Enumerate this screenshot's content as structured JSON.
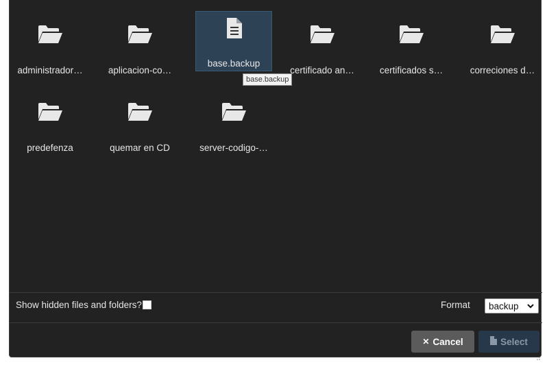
{
  "items": [
    {
      "name": "administrador…",
      "type": "folder"
    },
    {
      "name": "aplicacion-co…",
      "type": "folder"
    },
    {
      "name": "base.backup",
      "type": "file",
      "selected": true
    },
    {
      "name": "certificado an…",
      "type": "folder"
    },
    {
      "name": "certificados s…",
      "type": "folder"
    },
    {
      "name": "correciones d…",
      "type": "folder"
    },
    {
      "name": "predefenza",
      "type": "folder"
    },
    {
      "name": "quemar en CD",
      "type": "folder"
    },
    {
      "name": "server-codigo-…",
      "type": "folder"
    }
  ],
  "tooltip": "base.backup",
  "footer": {
    "show_hidden_label": "Show hidden files and folders?",
    "show_hidden_checked": false,
    "format_label": "Format",
    "format_value": "backup"
  },
  "buttons": {
    "cancel_glyph": "✕",
    "cancel_label": "Cancel",
    "select_label": "Select"
  },
  "colors": {
    "background": "#222222",
    "selected_bg": "#2e4256",
    "cancel_bg": "#5b5b5b",
    "select_bg": "#27384b"
  },
  "icons": {
    "folder": "folder-open-icon",
    "file": "file-text-icon",
    "select": "file-icon"
  }
}
